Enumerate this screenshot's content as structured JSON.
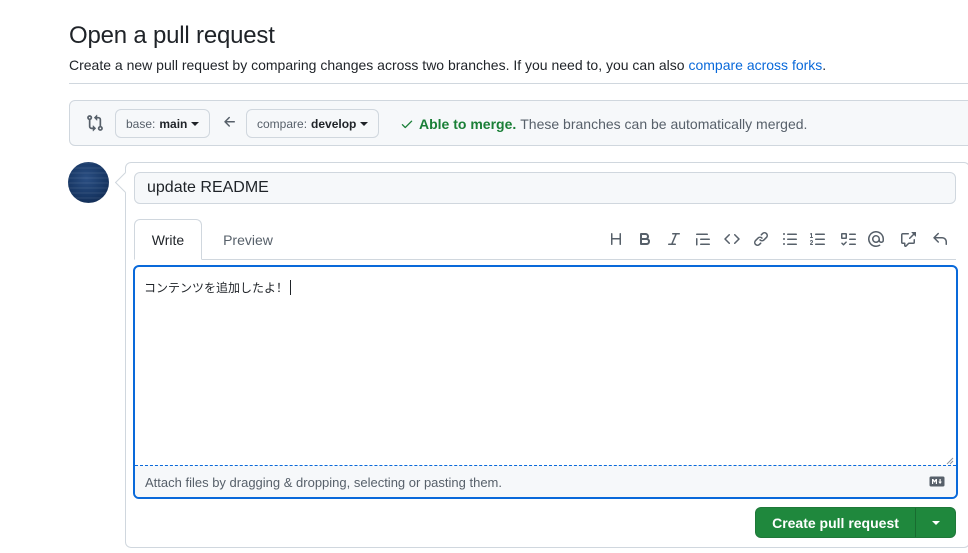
{
  "page": {
    "title": "Open a pull request",
    "subtitle_text": "Create a new pull request by comparing changes across two branches. If you need to, you can also",
    "subtitle_link": "compare across forks",
    "subtitle_end": "."
  },
  "range": {
    "base_prefix": "base:",
    "base_value": "main",
    "compare_prefix": "compare:",
    "compare_value": "develop",
    "merge_ok": "Able to merge.",
    "merge_msg": "These branches can be automatically merged."
  },
  "form": {
    "title_value": "update README",
    "tabs": {
      "write": "Write",
      "preview": "Preview"
    },
    "toolbar": [
      "heading-icon",
      "bold-icon",
      "italic-icon",
      "quote-icon",
      "code-icon",
      "link-icon",
      "unordered-list-icon",
      "ordered-list-icon",
      "task-list-icon",
      "mention-icon",
      "cross-reference-icon",
      "undo-icon"
    ],
    "body_value": "コンテンツを追加したよ！",
    "attach_hint": "Attach files by dragging & dropping, selecting or pasting them.",
    "submit_label": "Create pull request"
  },
  "colors": {
    "primary": "#1f883d",
    "link": "#0969da",
    "success": "#1a7f37",
    "focus": "#0969da"
  }
}
